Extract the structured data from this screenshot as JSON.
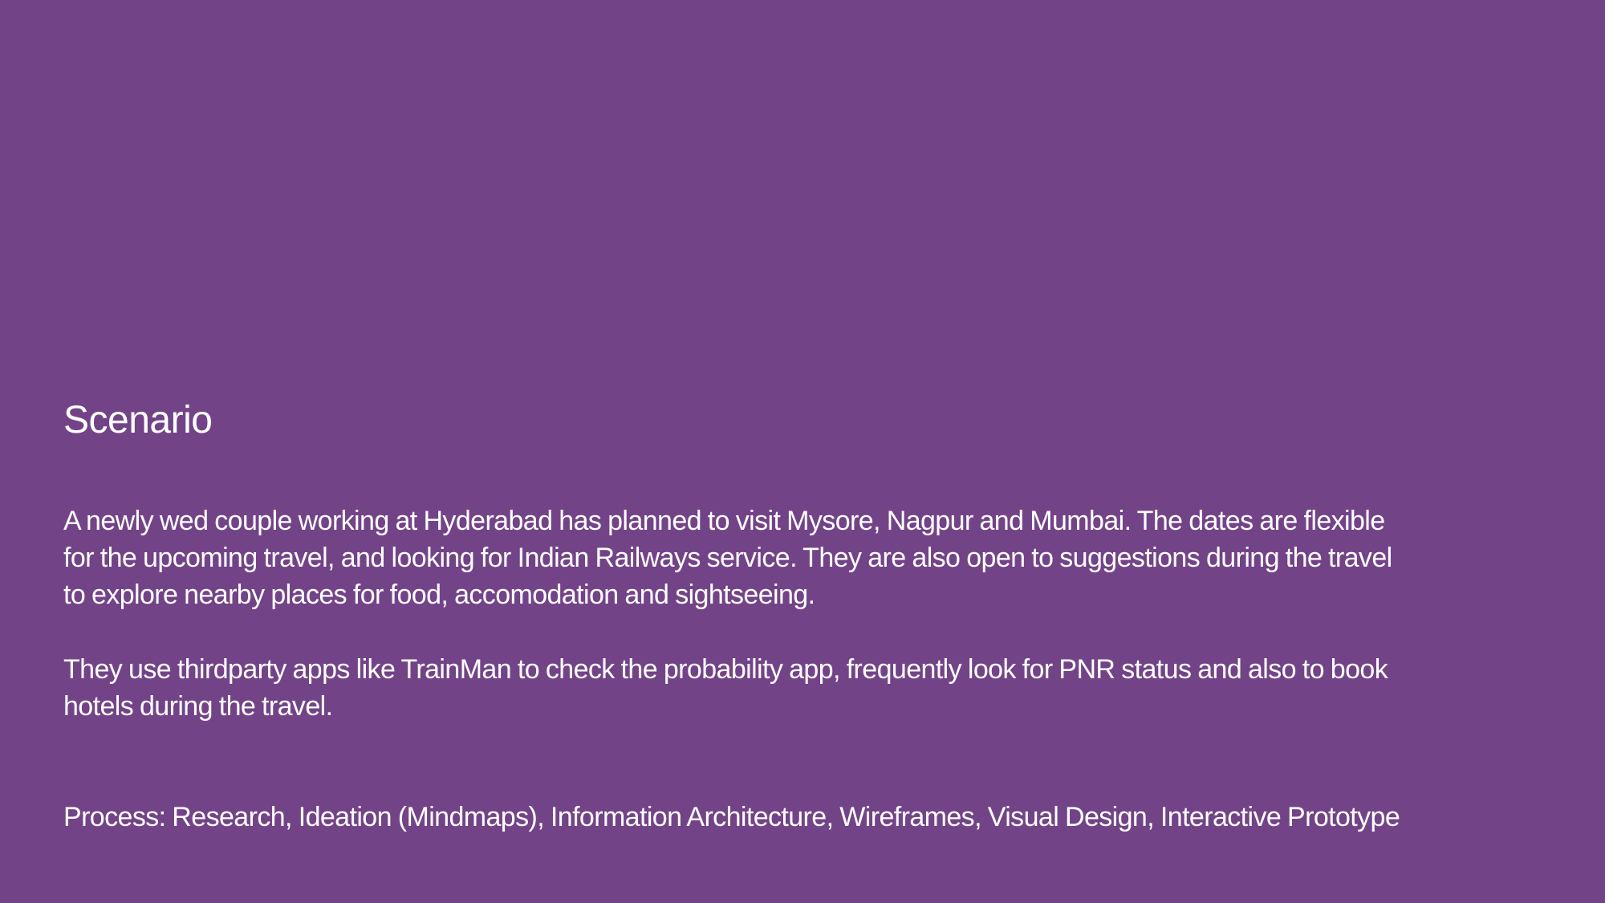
{
  "slide": {
    "background_color": "#734388",
    "text_color": "#ffffff",
    "title": "Scenario",
    "paragraphs": [
      {
        "lines": [
          "A newly wed couple working at Hyderabad has planned to visit Mysore, Nagpur and Mumbai. The dates are flexible",
          "for the upcoming travel, and looking for Indian Railways service. They are also open to suggestions during the travel",
          "to explore nearby places for food, accomodation and sightseeing."
        ]
      },
      {
        "lines": [
          "They use thirdparty apps like TrainMan to check the probability app, frequently look for PNR status and also to book",
          "hotels during the travel."
        ]
      }
    ],
    "process": "Process: Research, Ideation (Mindmaps), Information Architecture, Wireframes, Visual Design, Interactive Prototype"
  }
}
